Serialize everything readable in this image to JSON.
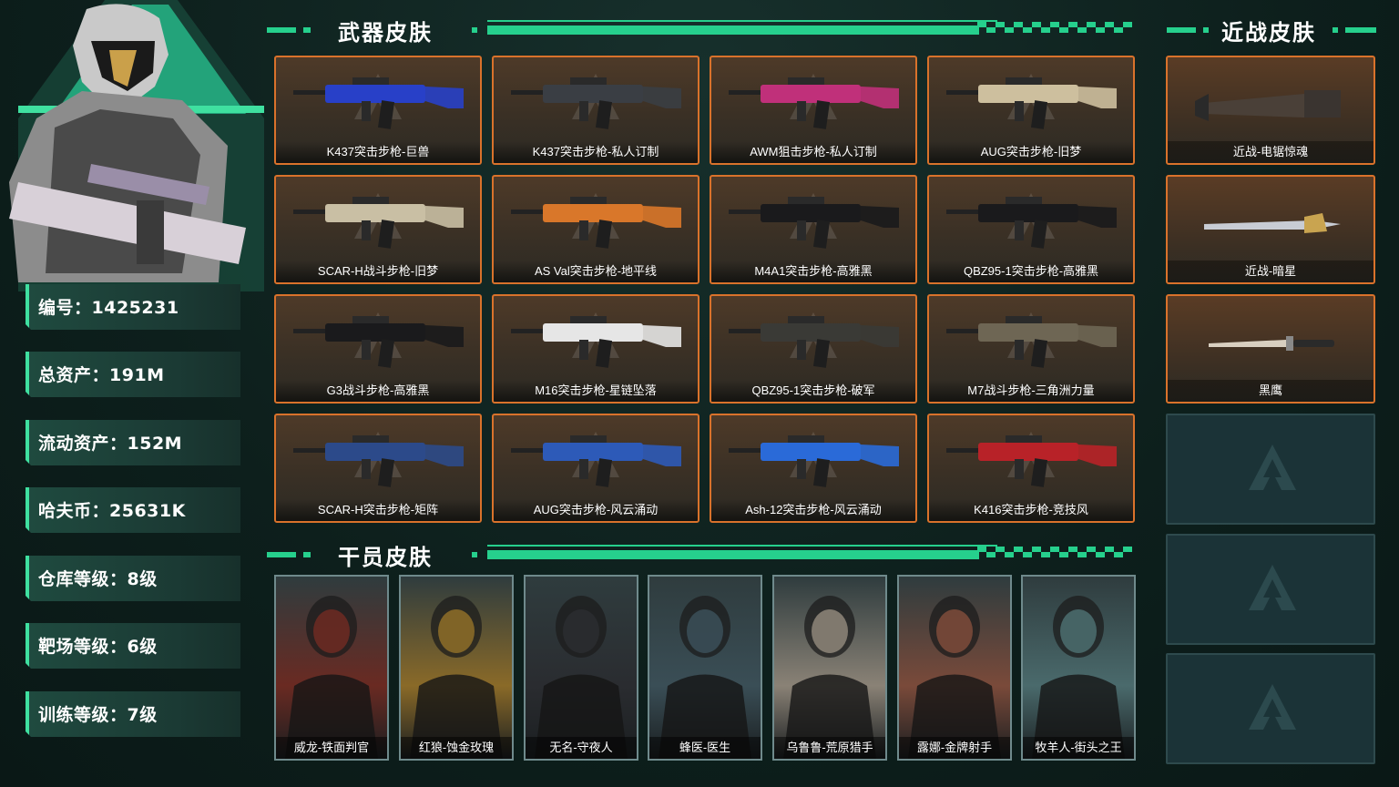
{
  "profile": {
    "stats": [
      {
        "label": "编号：1425231"
      },
      {
        "label": "总资产：191M"
      },
      {
        "label": "流动资产：152M"
      },
      {
        "label": "哈夫币：25631K"
      },
      {
        "label": "仓库等级：8级"
      },
      {
        "label": "靶场等级：6级"
      },
      {
        "label": "训练等级：7级"
      }
    ]
  },
  "sections": {
    "weapons_title": "武器皮肤",
    "operators_title": "干员皮肤",
    "melee_title": "近战皮肤"
  },
  "weapons": [
    {
      "name": "K437突击步枪-巨兽",
      "color": "#2840c8"
    },
    {
      "name": "K437突击步枪-私人订制",
      "color": "#3a3e44"
    },
    {
      "name": "AWM狙击步枪-私人订制",
      "color": "#c0307a"
    },
    {
      "name": "AUG突击步枪-旧梦",
      "color": "#cdbf9e"
    },
    {
      "name": "SCAR-H战斗步枪-旧梦",
      "color": "#c9bfa4"
    },
    {
      "name": "AS Val突击步枪-地平线",
      "color": "#d9772a"
    },
    {
      "name": "M4A1突击步枪-高雅黑",
      "color": "#1a1a1c"
    },
    {
      "name": "QBZ95-1突击步枪-高雅黑",
      "color": "#1a1a1c"
    },
    {
      "name": "G3战斗步枪-高雅黑",
      "color": "#1a1a1c"
    },
    {
      "name": "M16突击步枪-星链坠落",
      "color": "#e6e6e6"
    },
    {
      "name": "QBZ95-1突击步枪-破军",
      "color": "#3a3a36"
    },
    {
      "name": "M7战斗步枪-三角洲力量",
      "color": "#6e6654"
    },
    {
      "name": "SCAR-H突击步枪-矩阵",
      "color": "#2c4a8a"
    },
    {
      "name": "AUG突击步枪-风云涌动",
      "color": "#2d5ab8"
    },
    {
      "name": "Ash-12突击步枪-风云涌动",
      "color": "#2a6ad8"
    },
    {
      "name": "K416突击步枪-竞技风",
      "color": "#b82228"
    }
  ],
  "melee": [
    {
      "name": "近战-电锯惊魂"
    },
    {
      "name": "近战-暗星"
    },
    {
      "name": "黑鹰"
    }
  ],
  "operators": [
    {
      "name": "威龙-铁面判官",
      "color": "#6a2a22"
    },
    {
      "name": "红狼-蚀金玫瑰",
      "color": "#8a6a28"
    },
    {
      "name": "无名-守夜人",
      "color": "#2a2c30"
    },
    {
      "name": "蜂医-医生",
      "color": "#3a4e56"
    },
    {
      "name": "乌鲁鲁-荒原猎手",
      "color": "#8a8276"
    },
    {
      "name": "露娜-金牌射手",
      "color": "#7a4a3a"
    },
    {
      "name": "牧羊人-街头之王",
      "color": "#4a6a6c"
    }
  ],
  "colors": {
    "accent": "#26d08d",
    "card_border": "#d9722b",
    "empty_border": "#2e4a4d"
  }
}
